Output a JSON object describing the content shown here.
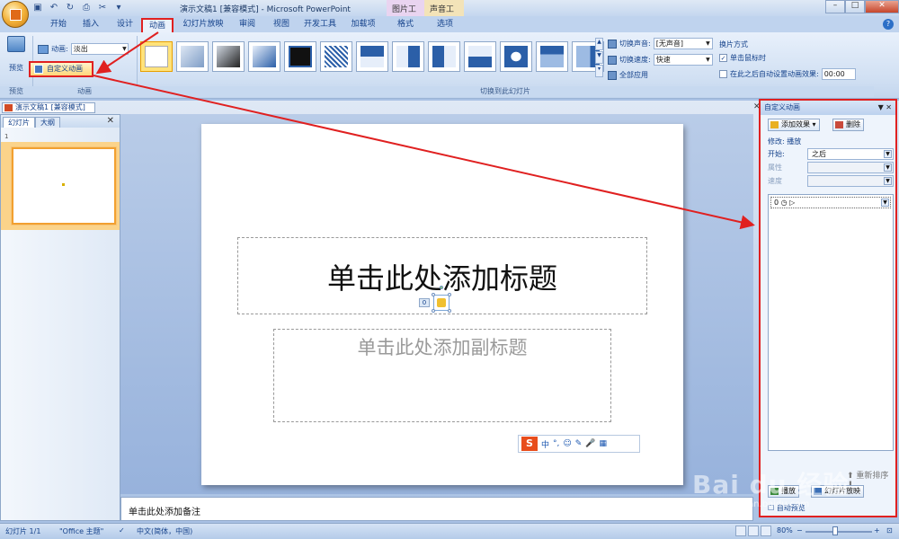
{
  "titlebar": {
    "title": "演示文稿1 [兼容模式] - Microsoft PowerPoint",
    "context_tabs": [
      "图片工具",
      "声音工具"
    ],
    "controls": [
      "–",
      "□",
      "✕"
    ]
  },
  "tabs": [
    {
      "label": "开始"
    },
    {
      "label": "插入"
    },
    {
      "label": "设计"
    },
    {
      "label": "动画",
      "active": true
    },
    {
      "label": "幻灯片放映"
    },
    {
      "label": "审阅"
    },
    {
      "label": "视图"
    },
    {
      "label": "开发工具"
    },
    {
      "label": "加载项"
    },
    {
      "label": "格式"
    },
    {
      "label": "选项"
    }
  ],
  "ribbon": {
    "preview": {
      "label": "预览",
      "group": "预览"
    },
    "animation": {
      "label": "动画:",
      "select_value": "淡出",
      "custom_button": "自定义动画",
      "group": "动画"
    },
    "transition": {
      "sound_label": "切换声音:",
      "sound_value": "[无声音]",
      "speed_label": "切换速度:",
      "speed_value": "快速",
      "apply_all": "全部应用",
      "group": "切换到此幻灯片"
    },
    "advance": {
      "title": "换片方式",
      "on_click": "单击鼠标时",
      "on_click_checked": true,
      "after_time": "在此之后自动设置动画效果:",
      "time_value": "00:00"
    }
  },
  "document_tab": "演示文稿1 [兼容模式]",
  "left_panel": {
    "tabs": [
      "幻灯片",
      "大纲"
    ],
    "close": "✕",
    "slide_number": "1"
  },
  "slide": {
    "title_placeholder": "单击此处添加标题",
    "subtitle_placeholder": "单击此处添加副标题",
    "sound_index": "0"
  },
  "ime_bar": {
    "logo": "S",
    "items": [
      "中",
      "°,",
      "☺",
      "✎",
      "🎤",
      "▦"
    ]
  },
  "notes": {
    "placeholder": "单击此处添加备注"
  },
  "task_pane": {
    "title": "自定义动画",
    "add_effect": "添加效果",
    "remove": "删除",
    "modify_label": "修改: 播放",
    "start_label": "开始:",
    "start_value": "之后",
    "property_label": "属性",
    "speed_label": "速度",
    "list_item": "0 ◷  ▷",
    "reorder_label": "重新排序",
    "play_button": "播放",
    "slideshow_button": "幻灯片放映",
    "autopreview": "自动预览"
  },
  "statusbar": {
    "slide_info": "幻灯片 1/1",
    "theme": "\"Office 主题\"",
    "language": "中文(简体，中国)",
    "zoom": "80%"
  },
  "watermark": {
    "text": "Bai du 经验",
    "sub": "jingyan.baidu.com"
  },
  "colors": {
    "highlight": "#e02020",
    "ribbon": "#d1e0f3",
    "accent": "#15428b"
  }
}
